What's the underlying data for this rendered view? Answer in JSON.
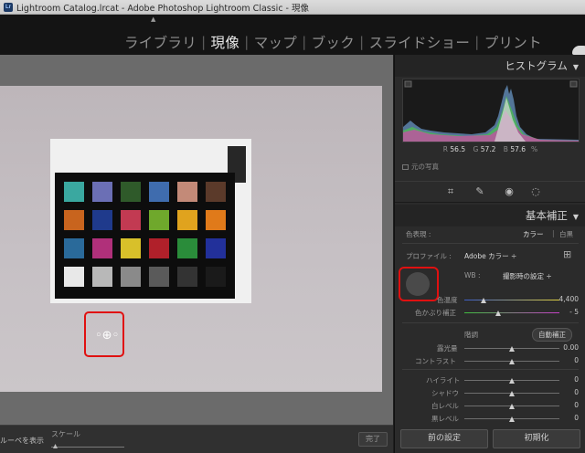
{
  "window": {
    "title": "Lightroom Catalog.lrcat - Adobe Photoshop Lightroom Classic - 現像",
    "app_icon": "Lr"
  },
  "modules": [
    {
      "label": "ライブラリ",
      "active": false
    },
    {
      "label": "現像",
      "active": true
    },
    {
      "label": "マップ",
      "active": false
    },
    {
      "label": "ブック",
      "active": false
    },
    {
      "label": "スライドショー",
      "active": false
    },
    {
      "label": "プリント",
      "active": false
    }
  ],
  "toolbar": {
    "loupe_label": "ルーペを表示",
    "scale_label": "スケール",
    "done_label": "完了"
  },
  "histogram": {
    "title": "ヒストグラム",
    "r_label": "R",
    "r_value": "56.5",
    "g_label": "G",
    "g_value": "57.2",
    "b_label": "B",
    "b_value": "57.6",
    "percent": "%",
    "original_photo": "元の写真"
  },
  "basic": {
    "title": "基本補正",
    "treatment_label": "色表現 :",
    "treatment_color": "カラー",
    "treatment_bw": "白黒",
    "profile_label": "プロファイル :",
    "profile_value": "Adobe カラー ÷",
    "wb_label": "WB :",
    "wb_value": "撮影時の設定 ÷",
    "temp_label": "色温度",
    "temp_value": "4,400",
    "tint_label": "色かぶり補正",
    "tint_value": "- 5",
    "tone_label": "階調",
    "auto_label": "自動補正",
    "exposure_label": "露光量",
    "exposure_value": "0.00",
    "contrast_label": "コントラスト",
    "contrast_value": "0",
    "highlights_label": "ハイライト",
    "highlights_value": "0",
    "shadows_label": "シャドウ",
    "shadows_value": "0",
    "whites_label": "白レベル",
    "whites_value": "0",
    "blacks_label": "黒レベル",
    "blacks_value": "0"
  },
  "buttons": {
    "previous": "前の設定",
    "reset": "初期化"
  },
  "colors": {
    "accent_red": "#e01010",
    "panel_bg": "#2b2b2b"
  }
}
